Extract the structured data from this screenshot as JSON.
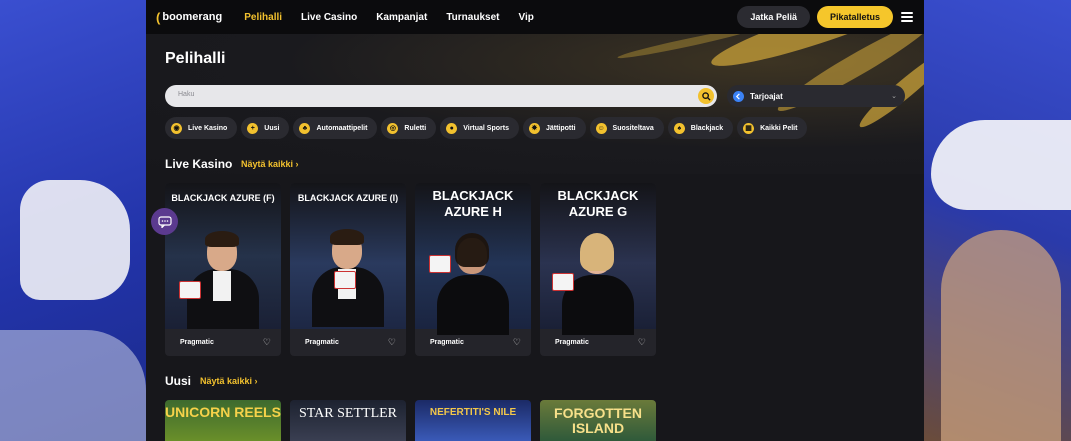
{
  "brand": {
    "logo": "boomerang"
  },
  "nav": [
    "Pelihalli",
    "Live Casino",
    "Kampanjat",
    "Turnaukset",
    "Vip"
  ],
  "actions": {
    "continue": "Jatka Peliä",
    "deposit": "Pikatalletus"
  },
  "page": {
    "title": "Pelihalli"
  },
  "search": {
    "placeholder": "Haku"
  },
  "provider": {
    "label": "Tarjoajat"
  },
  "chips": [
    "Live Kasino",
    "Uusi",
    "Automaattipelit",
    "Ruletti",
    "Virtual Sports",
    "Jättipotti",
    "Suositeltava",
    "Blackjack",
    "Kaikki Pelit"
  ],
  "sections": {
    "live": {
      "title": "Live Kasino",
      "link": "Näytä kaikki ›"
    },
    "new": {
      "title": "Uusi",
      "link": "Näytä kaikki ›"
    }
  },
  "live_games": [
    {
      "title": "BLACKJACK AZURE (F)",
      "provider": "Pragmatic"
    },
    {
      "title": "BLACKJACK AZURE (I)",
      "provider": "Pragmatic"
    },
    {
      "title": "BLACKJACK AZURE H",
      "provider": "Pragmatic"
    },
    {
      "title": "BLACKJACK AZURE G",
      "provider": "Pragmatic"
    }
  ],
  "new_games": [
    "UNICORN REELS",
    "STAR SETTLER",
    "NEFERTITI'S NILE",
    "FORGOTTEN ISLAND"
  ],
  "colors": {
    "accent": "#f2c12e",
    "background": "#17171b",
    "surface": "#2a2a30"
  }
}
